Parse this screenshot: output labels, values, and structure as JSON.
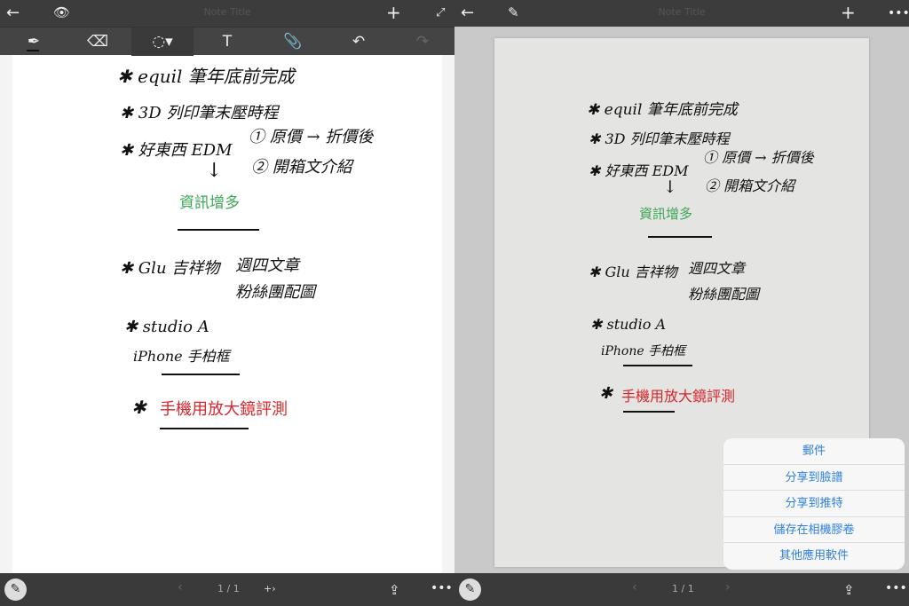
{
  "title": "Note Title",
  "page_indicator": "1 / 1",
  "notes": {
    "l1": "✱ equil 筆年底前完成",
    "l2": "✱ 3D 列印筆末壓時程",
    "l3": "✱ 好東西 EDM",
    "l3a": "① 原價 → 折價後",
    "l3b": "② 開箱文介紹",
    "green": "資訊增多",
    "l4": "✱ Glu 吉祥物",
    "l4a": "週四文章",
    "l4b": "粉絲團配圖",
    "l5": "✱ studio A",
    "l6": "iPhone 手柏框",
    "star": "✱",
    "red": "手機用放大鏡評測"
  },
  "share_menu": [
    "郵件",
    "分享到臉譜",
    "分享到推特",
    "儲存在相機膠卷",
    "其他應用軟件"
  ],
  "colors": {
    "green": "#3aa655",
    "red": "#d8262c",
    "menu_text": "#2f7fe0"
  }
}
